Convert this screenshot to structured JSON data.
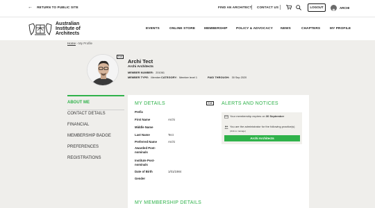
{
  "topbar": {
    "back_label": "RETURN TO PUBLIC SITE",
    "find_architect": "FIND AN ARCHITECT",
    "contact_us": "CONTACT US",
    "logout": "LOGOUT",
    "user_name": "ARCHI"
  },
  "brand": {
    "line1": "Australian",
    "line2": "Institute of",
    "line3": "Architects"
  },
  "nav": {
    "items": [
      "EVENTS",
      "ONLINE STORE",
      "MEMBERSHIP",
      "POLICY & ADVOCACY",
      "NEWS",
      "CHAPTERS",
      "MY PROFILE"
    ]
  },
  "breadcrumb": {
    "home": "Home",
    "separator": "›",
    "current": "My Profile"
  },
  "profile": {
    "edit_label": "Edit",
    "name": "Archi Tect",
    "organisation": "Archi Architects",
    "member_number_label": "MEMBER NUMBER:",
    "member_number": "201061",
    "member_type_label": "MEMBER TYPE:",
    "member_type": "Member",
    "category_label": "CATEGORY:",
    "category": "Member level 1",
    "paid_through_label": "PAID THROUGH:",
    "paid_through": "30 Sep 2020"
  },
  "sidebar": {
    "items": [
      "ABOUT ME",
      "CONTACT DETAILS",
      "FINANCIAL",
      "MEMBERSHIP BADGE",
      "PREFERENCES",
      "REGISTRATIONS"
    ]
  },
  "my_details": {
    "title": "MY DETAILS",
    "edit_label": "Edit",
    "fields": [
      {
        "label": "Prefix",
        "value": ""
      },
      {
        "label": "First Name",
        "value": "Archi"
      },
      {
        "label": "Middle Name",
        "value": ""
      },
      {
        "label": "Last Name",
        "value": "Tect"
      },
      {
        "label": "Preferred Name",
        "value": "Archi"
      },
      {
        "label": "Awarded Post-nominals",
        "value": ""
      },
      {
        "label": "Institute Post-nominals",
        "value": ""
      },
      {
        "label": "Date of Birth",
        "value": "1/01/1984"
      },
      {
        "label": "Gender",
        "value": ""
      }
    ]
  },
  "alerts": {
    "title": "ALERTS AND NOTICES",
    "expiry_text": "Your membership expires on",
    "expiry_date": "30 September",
    "admin_text": "You are the administrator for the following practice(s)",
    "admin_hint": "(click to manage)",
    "org_button": "Archi Architects"
  },
  "membership_details": {
    "title": "MY MEMBERSHIP DETAILS"
  },
  "colors": {
    "accent": "#2fb24a",
    "background": "#efeeeb"
  }
}
